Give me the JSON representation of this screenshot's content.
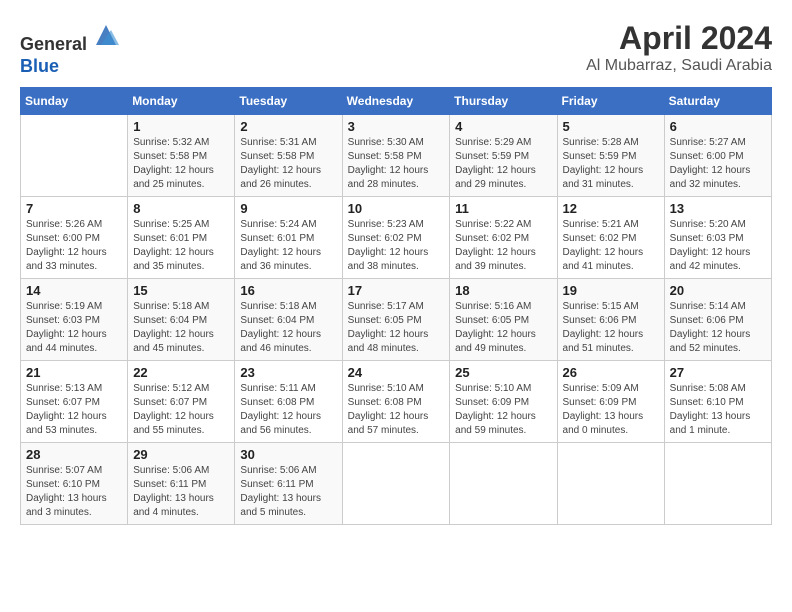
{
  "header": {
    "logo_line1": "General",
    "logo_line2": "Blue",
    "month": "April 2024",
    "location": "Al Mubarraz, Saudi Arabia"
  },
  "weekdays": [
    "Sunday",
    "Monday",
    "Tuesday",
    "Wednesday",
    "Thursday",
    "Friday",
    "Saturday"
  ],
  "weeks": [
    [
      {
        "day": "",
        "detail": ""
      },
      {
        "day": "1",
        "detail": "Sunrise: 5:32 AM\nSunset: 5:58 PM\nDaylight: 12 hours\nand 25 minutes."
      },
      {
        "day": "2",
        "detail": "Sunrise: 5:31 AM\nSunset: 5:58 PM\nDaylight: 12 hours\nand 26 minutes."
      },
      {
        "day": "3",
        "detail": "Sunrise: 5:30 AM\nSunset: 5:58 PM\nDaylight: 12 hours\nand 28 minutes."
      },
      {
        "day": "4",
        "detail": "Sunrise: 5:29 AM\nSunset: 5:59 PM\nDaylight: 12 hours\nand 29 minutes."
      },
      {
        "day": "5",
        "detail": "Sunrise: 5:28 AM\nSunset: 5:59 PM\nDaylight: 12 hours\nand 31 minutes."
      },
      {
        "day": "6",
        "detail": "Sunrise: 5:27 AM\nSunset: 6:00 PM\nDaylight: 12 hours\nand 32 minutes."
      }
    ],
    [
      {
        "day": "7",
        "detail": "Sunrise: 5:26 AM\nSunset: 6:00 PM\nDaylight: 12 hours\nand 33 minutes."
      },
      {
        "day": "8",
        "detail": "Sunrise: 5:25 AM\nSunset: 6:01 PM\nDaylight: 12 hours\nand 35 minutes."
      },
      {
        "day": "9",
        "detail": "Sunrise: 5:24 AM\nSunset: 6:01 PM\nDaylight: 12 hours\nand 36 minutes."
      },
      {
        "day": "10",
        "detail": "Sunrise: 5:23 AM\nSunset: 6:02 PM\nDaylight: 12 hours\nand 38 minutes."
      },
      {
        "day": "11",
        "detail": "Sunrise: 5:22 AM\nSunset: 6:02 PM\nDaylight: 12 hours\nand 39 minutes."
      },
      {
        "day": "12",
        "detail": "Sunrise: 5:21 AM\nSunset: 6:02 PM\nDaylight: 12 hours\nand 41 minutes."
      },
      {
        "day": "13",
        "detail": "Sunrise: 5:20 AM\nSunset: 6:03 PM\nDaylight: 12 hours\nand 42 minutes."
      }
    ],
    [
      {
        "day": "14",
        "detail": "Sunrise: 5:19 AM\nSunset: 6:03 PM\nDaylight: 12 hours\nand 44 minutes."
      },
      {
        "day": "15",
        "detail": "Sunrise: 5:18 AM\nSunset: 6:04 PM\nDaylight: 12 hours\nand 45 minutes."
      },
      {
        "day": "16",
        "detail": "Sunrise: 5:18 AM\nSunset: 6:04 PM\nDaylight: 12 hours\nand 46 minutes."
      },
      {
        "day": "17",
        "detail": "Sunrise: 5:17 AM\nSunset: 6:05 PM\nDaylight: 12 hours\nand 48 minutes."
      },
      {
        "day": "18",
        "detail": "Sunrise: 5:16 AM\nSunset: 6:05 PM\nDaylight: 12 hours\nand 49 minutes."
      },
      {
        "day": "19",
        "detail": "Sunrise: 5:15 AM\nSunset: 6:06 PM\nDaylight: 12 hours\nand 51 minutes."
      },
      {
        "day": "20",
        "detail": "Sunrise: 5:14 AM\nSunset: 6:06 PM\nDaylight: 12 hours\nand 52 minutes."
      }
    ],
    [
      {
        "day": "21",
        "detail": "Sunrise: 5:13 AM\nSunset: 6:07 PM\nDaylight: 12 hours\nand 53 minutes."
      },
      {
        "day": "22",
        "detail": "Sunrise: 5:12 AM\nSunset: 6:07 PM\nDaylight: 12 hours\nand 55 minutes."
      },
      {
        "day": "23",
        "detail": "Sunrise: 5:11 AM\nSunset: 6:08 PM\nDaylight: 12 hours\nand 56 minutes."
      },
      {
        "day": "24",
        "detail": "Sunrise: 5:10 AM\nSunset: 6:08 PM\nDaylight: 12 hours\nand 57 minutes."
      },
      {
        "day": "25",
        "detail": "Sunrise: 5:10 AM\nSunset: 6:09 PM\nDaylight: 12 hours\nand 59 minutes."
      },
      {
        "day": "26",
        "detail": "Sunrise: 5:09 AM\nSunset: 6:09 PM\nDaylight: 13 hours\nand 0 minutes."
      },
      {
        "day": "27",
        "detail": "Sunrise: 5:08 AM\nSunset: 6:10 PM\nDaylight: 13 hours\nand 1 minute."
      }
    ],
    [
      {
        "day": "28",
        "detail": "Sunrise: 5:07 AM\nSunset: 6:10 PM\nDaylight: 13 hours\nand 3 minutes."
      },
      {
        "day": "29",
        "detail": "Sunrise: 5:06 AM\nSunset: 6:11 PM\nDaylight: 13 hours\nand 4 minutes."
      },
      {
        "day": "30",
        "detail": "Sunrise: 5:06 AM\nSunset: 6:11 PM\nDaylight: 13 hours\nand 5 minutes."
      },
      {
        "day": "",
        "detail": ""
      },
      {
        "day": "",
        "detail": ""
      },
      {
        "day": "",
        "detail": ""
      },
      {
        "day": "",
        "detail": ""
      }
    ]
  ]
}
